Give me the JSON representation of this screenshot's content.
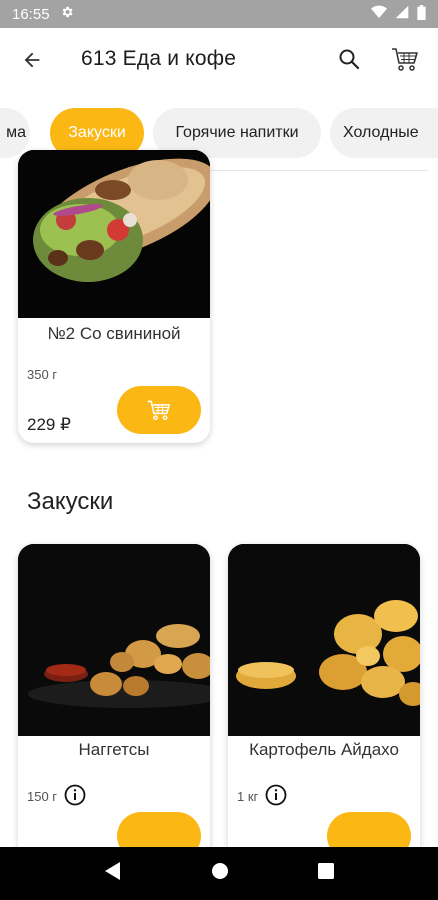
{
  "status_bar": {
    "time": "16:55",
    "settings_icon": "gear-icon"
  },
  "header": {
    "title": "613 Еда и кофе",
    "back_icon": "arrow-left-icon",
    "search_icon": "search-icon",
    "cart_icon": "cart-icon"
  },
  "tabs": [
    {
      "label": "ма"
    },
    {
      "label": "Закуски",
      "active": true
    },
    {
      "label": "Горячие напитки"
    },
    {
      "label": "Холодные"
    }
  ],
  "top_product": {
    "name": "№2 Со свининой",
    "weight": "350 г",
    "price": "229 ₽"
  },
  "section": {
    "title": "Закуски"
  },
  "products": [
    {
      "name": "Наггетсы",
      "weight": "150 г"
    },
    {
      "name": "Картофель Айдахо",
      "weight": "1 кг"
    }
  ],
  "colors": {
    "accent": "#fbb713",
    "status_bar": "#a3a3a3"
  }
}
